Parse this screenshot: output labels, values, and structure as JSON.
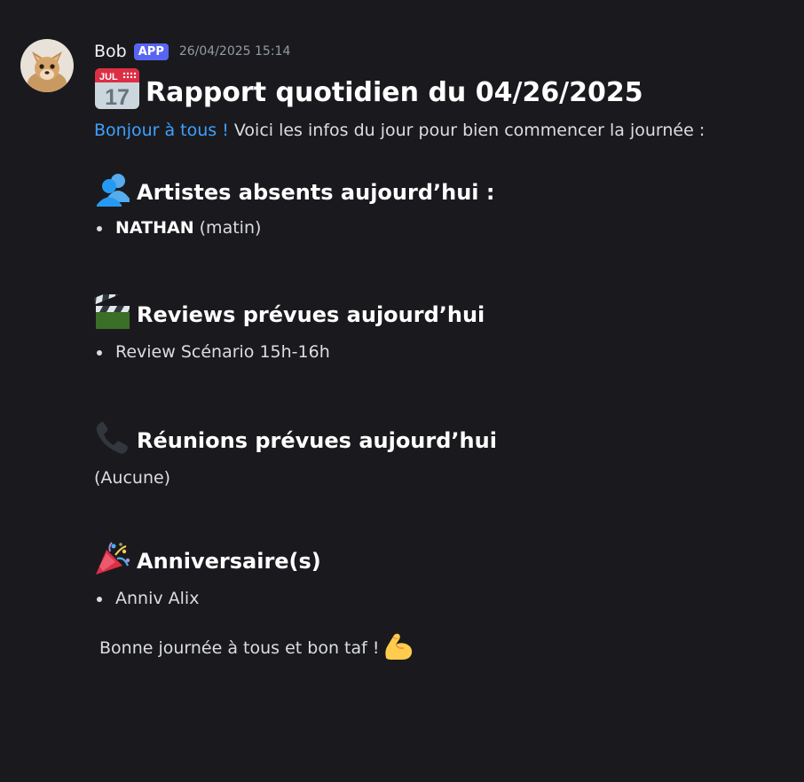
{
  "message": {
    "author": "Bob",
    "badge": "APP",
    "timestamp": "26/04/2025 15:14",
    "title": "Rapport quotidien du 04/26/2025",
    "greeting_link": "Bonjour à tous !",
    "greeting_rest": " Voici les infos du jour pour bien commencer la journée :",
    "sections": [
      {
        "icon": "busts-in-silhouette-icon",
        "heading": "Artistes absents aujourd’hui :",
        "items": [
          {
            "bold": "NATHAN",
            "rest": " (matin)"
          }
        ]
      },
      {
        "icon": "clapper-board-icon",
        "heading": "Reviews prévues aujourd’hui",
        "items": [
          {
            "text": "Review Scénario 15h-16h"
          }
        ]
      },
      {
        "icon": "telephone-receiver-icon",
        "heading": "Réunions prévues aujourd’hui",
        "plain": "(Aucune)"
      },
      {
        "icon": "party-popper-icon",
        "heading": "Anniversaire(s)",
        "items": [
          {
            "text": "Anniv Alix"
          }
        ]
      }
    ],
    "closing": "Bonne journée à tous et bon taf !",
    "closing_icon": "flexed-biceps-icon",
    "title_icon": "calendar-icon",
    "calendar_month": "JUL",
    "calendar_day": "17"
  },
  "colors": {
    "background": "#1a1a1e",
    "link": "#3fa0ff",
    "badge": "#5865f2",
    "text": "#dbdee1",
    "heading": "#ffffff",
    "muted": "#949ba4"
  }
}
